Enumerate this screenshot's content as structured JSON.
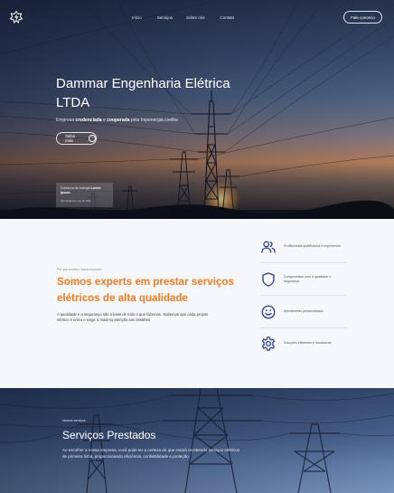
{
  "nav": {
    "links": [
      "Início",
      "Serviços",
      "Sobre nós",
      "Contato"
    ],
    "contact_button": "Fale conosco"
  },
  "hero": {
    "title": "Dammar Engenharia Elétrica LTDA",
    "subtitle_pre": "Empresa ",
    "subtitle_b1": "credenciada",
    "subtitle_mid": " e ",
    "subtitle_b2": "cooperada",
    "subtitle_post": " pela Impenergia.coelba",
    "more_button": "Saiba mais",
    "card_text_pre": "Extrutura de energia ",
    "card_text_bold": "Lorem ipsum",
    "card_sub": "Nós atingimos o céu do chão"
  },
  "about": {
    "overline": "Por que escolher nossa empresa?",
    "title": "Somos experts em prestar serviços elétricos de alta qualidade",
    "text": "A qualidade e a segurança são a base de tudo o que fazemos. Sabemos que cada projeto elétrico é único e exige a máxima atenção aos detalhes.",
    "features": [
      {
        "icon": "users-icon",
        "label": "Profissionais qualificados e experientes"
      },
      {
        "icon": "shield-icon",
        "label": "Compromisso com a qualidade e segurança"
      },
      {
        "icon": "smile-icon",
        "label": "Atendimento personalizado"
      },
      {
        "icon": "gear-icon",
        "label": "Soluções eficientes e inovadoras"
      }
    ],
    "accent_color": "#ef7a22",
    "icon_color": "#2d3e8c"
  },
  "services": {
    "overline": "Nossos serviços",
    "title": "Serviços Prestados",
    "text": "Ao escolher a nossa empresa, você pode ter a certeza de que estará recebendo serviços elétricos de primeira linha, proporcionando eficiência, confiabilidade e proteção."
  }
}
